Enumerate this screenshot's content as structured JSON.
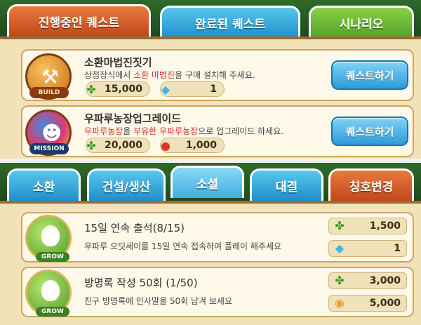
{
  "quest_tabs": [
    {
      "label": "진행중인 퀘스트",
      "state": "active"
    },
    {
      "label": "완료된 퀘스트",
      "state": "inactive"
    },
    {
      "label": "시나리오",
      "state": "inactive"
    }
  ],
  "quests": [
    {
      "badge": "BUILD",
      "badge_icon": "hammer-icon",
      "title": "소환마법진짓기",
      "desc_parts": [
        "상점장식에서 ",
        "소환 마법진",
        "을 구매 설치해 주세요."
      ],
      "rewards": [
        {
          "icon": "clover-icon",
          "value": "15,000"
        },
        {
          "icon": "diamond-icon",
          "value": "1"
        }
      ],
      "button": "퀘스트하기"
    },
    {
      "badge": "MISSION",
      "badge_icon": "character-icon",
      "title": "우파루농장업그레이드",
      "desc_parts": [
        "우파루농장",
        "을 ",
        "부유한 우파루농장",
        "으로 업그레이드 하세요."
      ],
      "rewards": [
        {
          "icon": "clover-icon",
          "value": "20,000"
        },
        {
          "icon": "tomato-icon",
          "value": "1,000"
        }
      ],
      "button": "퀘스트하기"
    }
  ],
  "achievement_tabs": [
    {
      "label": "소환"
    },
    {
      "label": "건설/생산"
    },
    {
      "label": "소셜"
    },
    {
      "label": "대결"
    },
    {
      "label": "칭호변경"
    }
  ],
  "achievements": [
    {
      "badge": "GROW",
      "title": "15일 연속 출석(8/15)",
      "desc": "우파루 오딧세이를 15일 연속 접속하여 플레이 해주세요",
      "rewards": [
        {
          "icon": "clover-icon",
          "value": "1,500"
        },
        {
          "icon": "diamond-icon",
          "value": "1"
        }
      ]
    },
    {
      "badge": "GROW",
      "title": "방명록 작성 50회 (1/50)",
      "desc": "친구 방명록에 인사말을 50회 남겨 보세요",
      "rewards": [
        {
          "icon": "clover-icon",
          "value": "3,000"
        },
        {
          "icon": "coin-icon",
          "value": "5,000"
        }
      ]
    }
  ],
  "colors": {
    "accent_orange": "#c1491c",
    "accent_blue": "#2d9bd8",
    "accent_green": "#52a12c",
    "highlight_red": "#d3342c"
  }
}
